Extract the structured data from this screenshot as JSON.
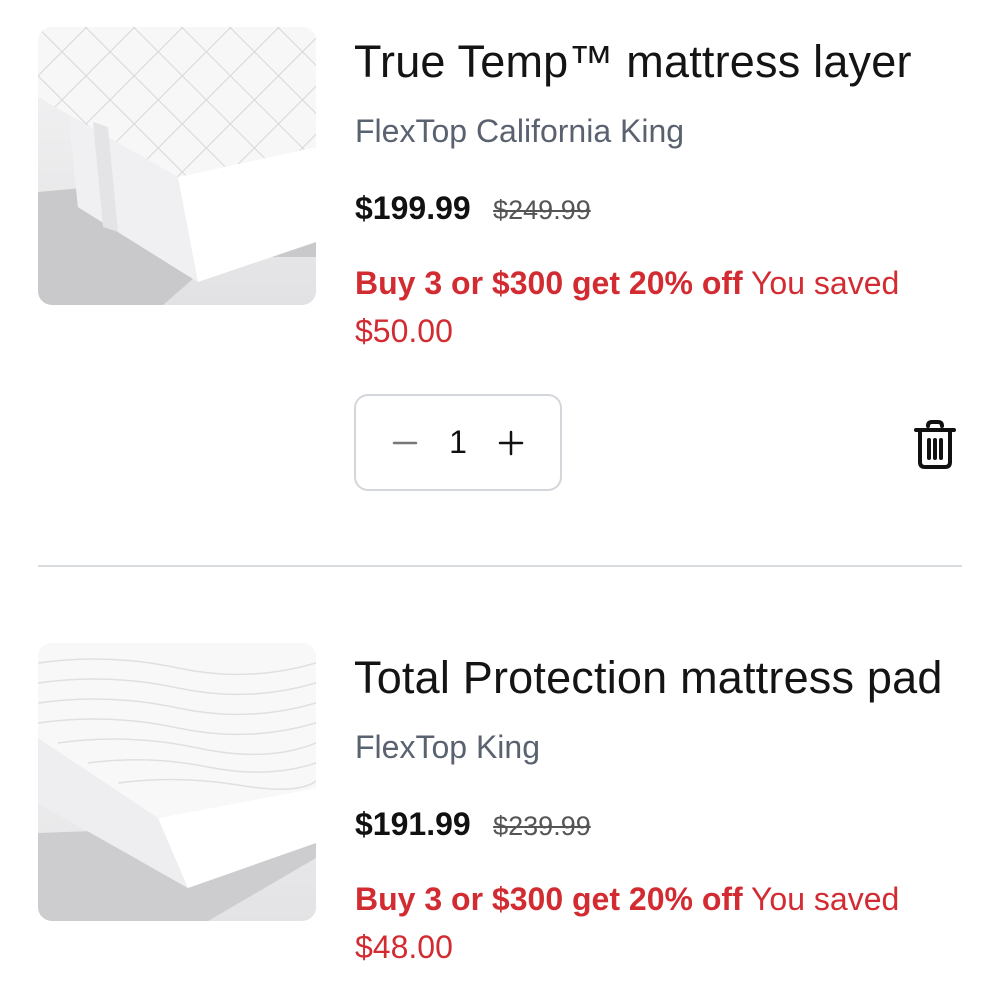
{
  "cart_items": [
    {
      "title": "True Temp™ mattress layer",
      "variant": "FlexTop California King",
      "price": "$199.99",
      "original_price": "$249.99",
      "promo_label": "Buy 3 or $300 get 20% off",
      "saved_label": "You saved",
      "saved_amount": "$50.00",
      "quantity": "1",
      "image_icon": "quilted-mattress-layer-image"
    },
    {
      "title": "Total Protection mattress pad",
      "variant": "FlexTop King",
      "price": "$191.99",
      "original_price": "$239.99",
      "promo_label": "Buy 3 or $300 get 20% off",
      "saved_label": "You saved",
      "saved_amount": "$48.00",
      "image_icon": "mattress-pad-image"
    }
  ],
  "icons": {
    "decrement": "minus-icon",
    "increment": "plus-icon",
    "remove": "trash-icon"
  },
  "colors": {
    "promo_red": "#d22c32",
    "variant_gray": "#5a6270",
    "border_gray": "#d3d6da"
  }
}
